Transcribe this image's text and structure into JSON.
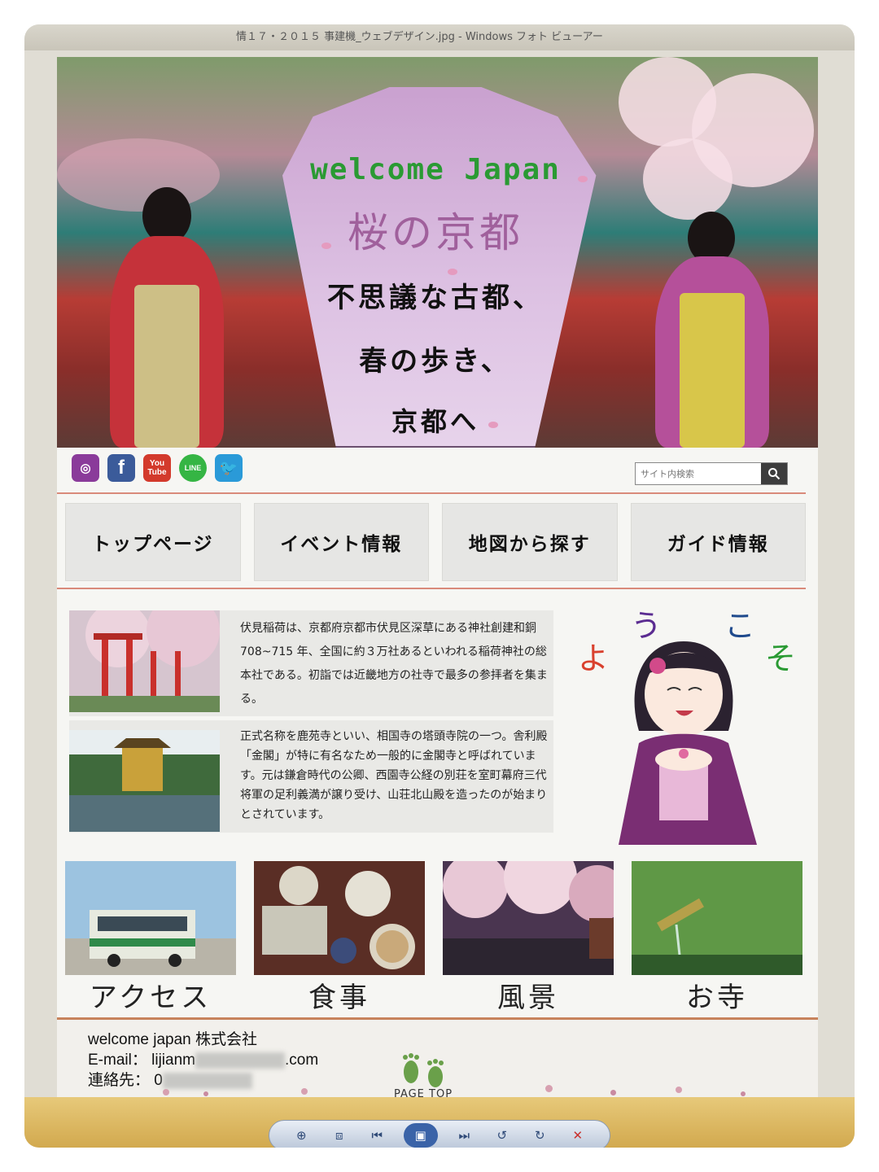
{
  "window": {
    "title_fragment": "情１７・２０１５ 事建機_ウェブデザイン.jpg - Windows フォト ビューアー"
  },
  "hero": {
    "welcome": "welcome  Japan",
    "title": "桜の京都",
    "line1": "不思議な古都、",
    "line2": "春の歩き、",
    "line3": "京都へ"
  },
  "social": [
    {
      "name": "instagram-icon",
      "glyph": "◎"
    },
    {
      "name": "facebook-icon",
      "glyph": "f"
    },
    {
      "name": "youtube-icon",
      "glyph": "You Tube"
    },
    {
      "name": "line-icon",
      "glyph": "LINE"
    },
    {
      "name": "twitter-icon",
      "glyph": "🐦"
    }
  ],
  "search": {
    "placeholder": "サイト内検索"
  },
  "nav": [
    "トップページ",
    "イベント情報",
    "地図から探す",
    "ガイド情報"
  ],
  "articles": [
    {
      "text": "伏見稲荷は、京都府京都市伏見区深草にある神社創建和銅 708~715 年、全国に約３万社あるといわれる稲荷神社の総本社である。初詣では近畿地方の社寺で最多の参拝者を集まる。"
    },
    {
      "text": "正式名称を鹿苑寺といい、相国寺の塔頭寺院の一つ。舎利殿「金閣」が特に有名なため一般的に金閣寺と呼ばれています。元は鎌倉時代の公卿、西園寺公経の別荘を室町幕府三代将軍の足利義満が譲り受け、山荘北山殿を造ったのが始まりとされています。"
    }
  ],
  "mascot": {
    "yo": "よ",
    "u": "う",
    "ko": "こ",
    "so": "そ"
  },
  "categories": [
    "アクセス",
    "食事",
    "風景",
    "お寺"
  ],
  "footer": {
    "company": "welcome japan 株式会社",
    "email_label": "E-mail：",
    "email_start": "lijianm",
    "email_end": ".com",
    "contact_label": "連絡先：",
    "contact_start": "0",
    "page_top": "PAGE  TOP"
  },
  "colors": {
    "accent_rule": "#d98a7a",
    "nav_bg": "#e6e6e4",
    "welcome_green": "#2a9a33",
    "title_purple": "#a0609c"
  }
}
